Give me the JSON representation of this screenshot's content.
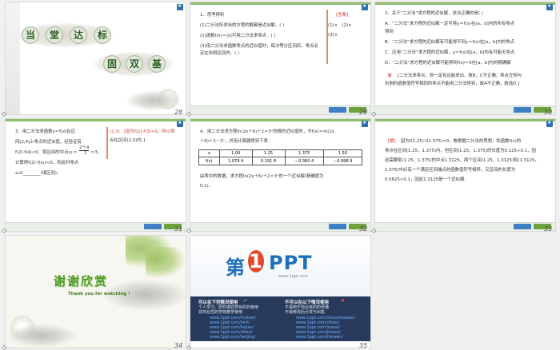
{
  "slides": [
    {
      "number": "28",
      "title_chars": [
        "当",
        "堂",
        "达",
        "标"
      ],
      "subtitle_chars": [
        "固",
        "双",
        "基"
      ]
    },
    {
      "number": "29",
      "lines": [
        "1．思考辨析",
        "(1)二分法所求出的方程的解都是近似解．(    )",
        "(2)函数f(x)＝|x|可用二分法求零点．(    )",
        "(3)用二分法求函数零点的近似值时，每次等分区间后，零点必定在右侧区间内．(    )"
      ],
      "answer_label": "[答案]",
      "answers": [
        "(1)×　(2)×",
        "(3)×"
      ]
    },
    {
      "number": "30",
      "lines": [
        "2．关于“二分法”求方程的近似解，说法正确的是(    )",
        "A．“二分法”求方程的近似解一定可将y＝f(x)在[a，b]内的所有零点",
        "得到",
        "B．“二分法”求方程的近似解有可能得不到y＝f(x)在[a，b]内的零点",
        "C．应用“二分法”求方程的近似解，y＝f(x)在[a，b]内有可能无零点",
        "D．“二分法”求方程的近似解可能得到f(x)＝0在[a，b]内的精确解"
      ],
      "answer_letter": "D",
      "explanation": [
        "[二分法求零点，则一定有且能求出，故B，C不正确；零点左侧与",
        "右侧的函数值符号相同的零点不能用二分法得到，故A不正确，故选D.]"
      ]
    },
    {
      "number": "31",
      "lines": [
        "3．用二分法求函数y＝f(x)在区",
        "间[2,4]上零点的近似值，经验证有",
        "f(2)·f(4)<0．取区间的中点x₁＝",
        "计算得f(2)·f(x₁)<0，则此时零点",
        "x₀∈________(填区间)．"
      ],
      "frac_num": "2＋4",
      "frac_den": "2",
      "x1_eq": "＝3，",
      "answer_lines": [
        "(2,3)　[因为f(2)·f(3)<0，所以零",
        "点在区间(2,3)内．]"
      ]
    },
    {
      "number": "32",
      "lines": [
        "4．用二分法求方程ln(2x＋6)＋2＝3ˣ的根的近似值时，令f(x)＝ln(2x",
        "＋6)＋2－3ˣ，并用计算器得到下表："
      ],
      "table": {
        "header": [
          "x",
          "1.00",
          "1.25",
          "1.375",
          "1.50"
        ],
        "row_label": "f(x)",
        "row": [
          "1.079 4",
          "0.191 8",
          "－0.360 4",
          "－0.998 9"
        ]
      },
      "conclusion": [
        "由表中的数据，求方程ln(2x＋6)＋2＝3ˣ的一个近似解(精确度为",
        "0.1)．"
      ]
    },
    {
      "number": "33",
      "label": "[解]",
      "lines": [
        "因为f(1.25)·f(1.375)<0，故根据二分法的思想，知函数f(x)的",
        "零点在区间(1.25，1.375)内，但区间(1.25，1.375)的长度为0.125>0.1，因",
        "此需要取(1.25，1.375)的中点1.3125，两个区间(1.25，1.3125)和(1.3125，",
        "1.375)中必有一个满足区间端点的函数值符号相异，又区间的长度为",
        "0.0625<0.1，因此1.3125是一个近似解．"
      ]
    },
    {
      "number": "34",
      "thanks": "谢谢欣赏",
      "thanks_en": "Thank you for watching !"
    },
    {
      "number": "35",
      "logo_a": "第",
      "logo_b": "1",
      "logo_c": "PPT",
      "logo_sub": "www.1ppt.com",
      "left_heading": "可以在下列情况使用",
      "right_heading": "不可以在以下情况使用",
      "left_lines": [
        "个人学习、研究或欣赏目的的使用",
        "非商业性的学校教学使用",
        "www.1ppt.com/moban/",
        "www.1ppt.com/jieri/",
        "www.1ppt.com/kejian/",
        "www.1ppt.com/ziliao/",
        "www.1ppt.com/beijing/"
      ],
      "right_lines": [
        "不得用于商业目的的传播",
        "不得修改后分发与出售",
        "www.1ppt.com/shouchaobao/",
        "www.1ppt.com/ziliao/",
        "www.1ppt.com/xiazai/",
        "www.1ppt.com/jiaoan/",
        "www.1ppt.com/fanwen/"
      ]
    }
  ]
}
